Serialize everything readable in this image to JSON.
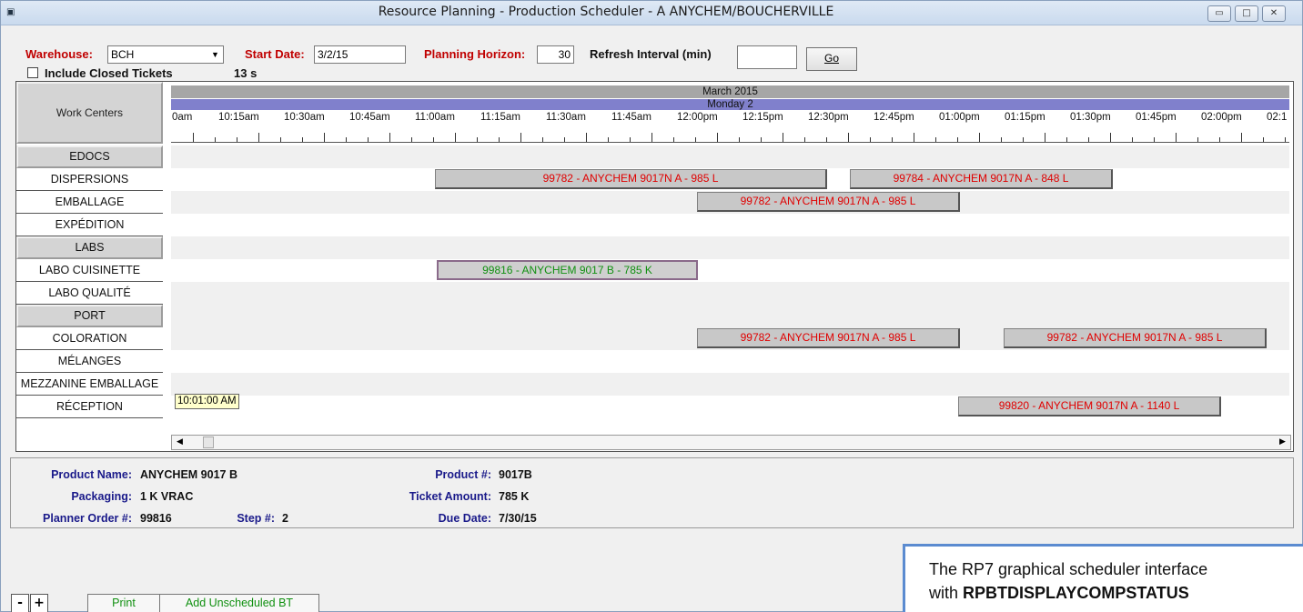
{
  "window": {
    "title": "Resource Planning - Production Scheduler - A ANYCHEM/BOUCHERVILLE"
  },
  "toolbar": {
    "warehouse_label": "Warehouse:",
    "warehouse_value": "BCH",
    "start_date_label": "Start Date:",
    "start_date_value": "3/2/15",
    "planning_horizon_label": "Planning Horizon:",
    "planning_horizon_value": "30",
    "refresh_label": "Refresh Interval (min)",
    "refresh_value": "",
    "go_label": "Go",
    "include_closed_label": "Include Closed Tickets",
    "elapsed": "13 s"
  },
  "schedule": {
    "work_centers_header": "Work Centers",
    "month": "March 2015",
    "day": "Monday 2",
    "time_labels": [
      "0am",
      "10:15am",
      "10:30am",
      "10:45am",
      "11:00am",
      "11:15am",
      "11:30am",
      "11:45am",
      "12:00pm",
      "12:15pm",
      "12:30pm",
      "12:45pm",
      "01:00pm",
      "01:15pm",
      "01:30pm",
      "01:45pm",
      "02:00pm",
      "02:1"
    ],
    "rows": [
      {
        "label": "EDOCS",
        "group": true
      },
      {
        "label": "DISPERSIONS",
        "group": false
      },
      {
        "label": "EMBALLAGE",
        "group": false
      },
      {
        "label": "EXPÉDITION",
        "group": false
      },
      {
        "label": "LABS",
        "group": true
      },
      {
        "label": "LABO CUISINETTE",
        "group": false
      },
      {
        "label": "LABO QUALITÉ",
        "group": false
      },
      {
        "label": "PORT",
        "group": true
      },
      {
        "label": "COLORATION",
        "group": false
      },
      {
        "label": "MÉLANGES",
        "group": false
      },
      {
        "label": "MEZZANINE EMBALLAGE",
        "group": false
      },
      {
        "label": "RÉCEPTION",
        "group": false
      }
    ],
    "bars": [
      {
        "row": 1,
        "text": "99782 - ANYCHEM 9017N A - 985 L",
        "selected": false
      },
      {
        "row": 1,
        "text": "99784 - ANYCHEM 9017N A - 848 L",
        "selected": false
      },
      {
        "row": 2,
        "text": "99782 - ANYCHEM 9017N A - 985 L",
        "selected": false
      },
      {
        "row": 5,
        "text": "99816 - ANYCHEM 9017 B - 785 K",
        "selected": true
      },
      {
        "row": 8,
        "text": "99782 - ANYCHEM 9017N A - 985 L",
        "selected": false
      },
      {
        "row": 8,
        "text": "99782 - ANYCHEM 9017N A - 985 L",
        "selected": false
      },
      {
        "row": 11,
        "text": "99820 - ANYCHEM 9017N A - 1140 L",
        "selected": false
      }
    ],
    "current_time": "10:01:00 AM"
  },
  "details": {
    "product_name_label": "Product Name:",
    "product_name": "ANYCHEM 9017 B",
    "packaging_label": "Packaging:",
    "packaging": "1 K VRAC",
    "planner_order_label": "Planner Order #:",
    "planner_order": "99816",
    "step_label": "Step #:",
    "step": "2",
    "product_num_label": "Product #:",
    "product_num": "9017B",
    "ticket_amount_label": "Ticket Amount:",
    "ticket_amount": "785 K",
    "due_date_label": "Due Date:",
    "due_date": "7/30/15"
  },
  "footer": {
    "zoom_out": "-",
    "zoom_in": "+",
    "print": "Print",
    "add_unscheduled": "Add Unscheduled BT"
  },
  "callout": {
    "line1": "The RP7 graphical scheduler interface",
    "line2_prefix": "with",
    "line2_bold": "RPBTDISPLAYCOMPSTATUS"
  }
}
